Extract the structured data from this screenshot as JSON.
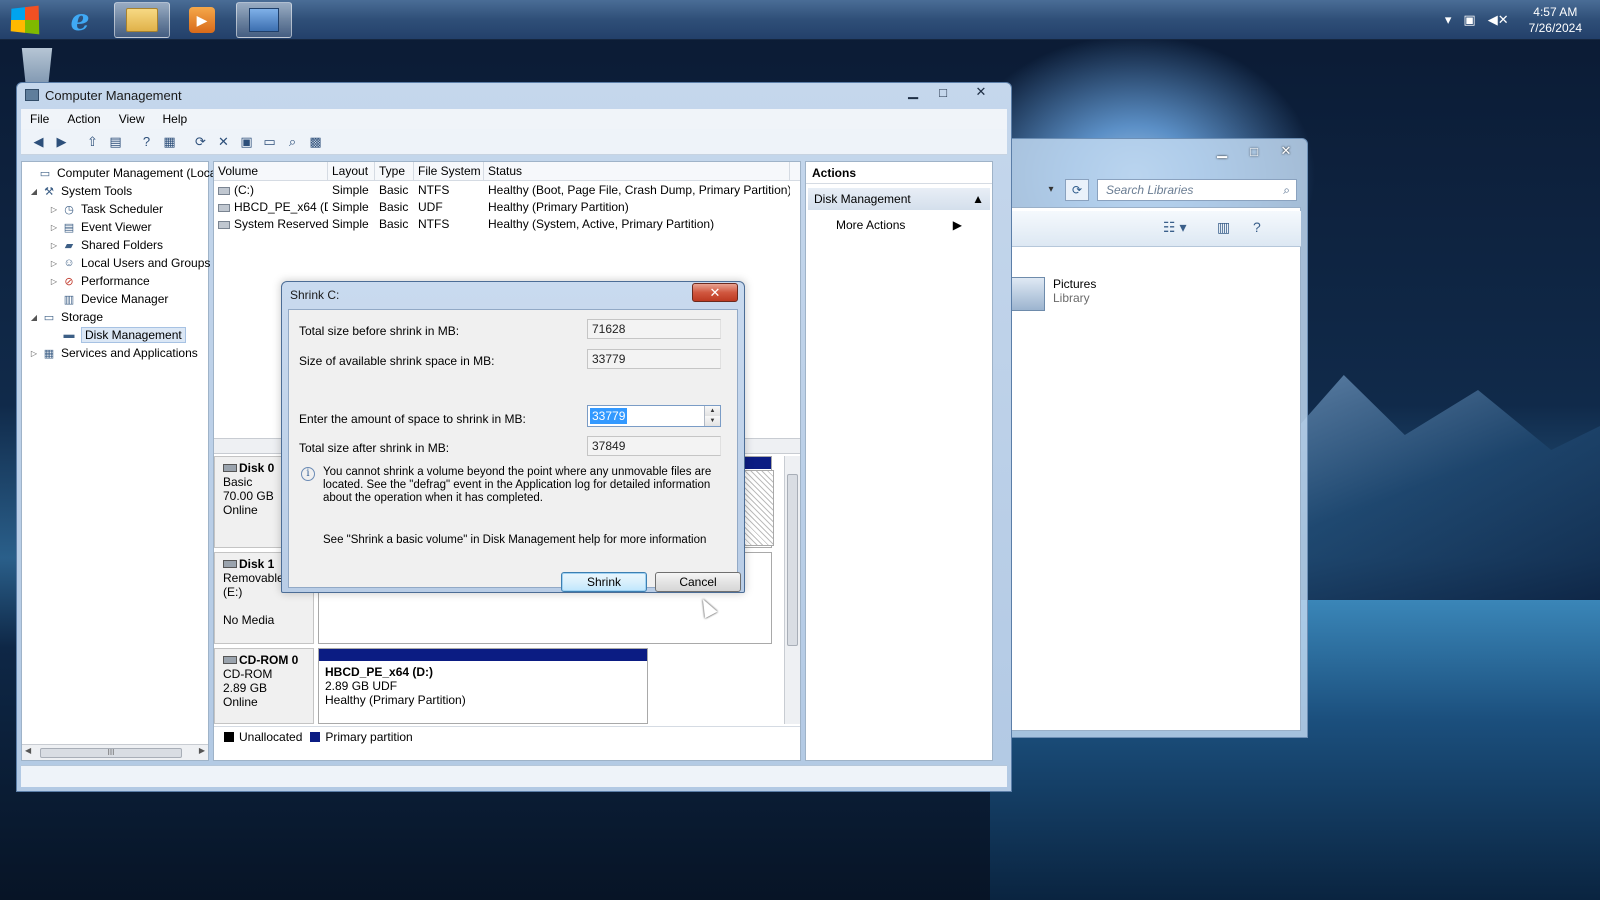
{
  "taskbar": {
    "clock_time": "4:57 AM",
    "clock_date": "7/26/2024",
    "apps": [
      "start-orb",
      "internet-explorer",
      "windows-explorer",
      "media-player",
      "computer-management"
    ],
    "tray_icons": [
      "show-hidden-icons",
      "network-icon",
      "volume-muted-icon"
    ]
  },
  "explorer": {
    "search_placeholder": "Search Libraries",
    "item_name": "Pictures",
    "item_type": "Library"
  },
  "window": {
    "title": "Computer Management",
    "menu": [
      "File",
      "Action",
      "View",
      "Help"
    ]
  },
  "tree": {
    "root": "Computer Management (Local",
    "system_tools": "System Tools",
    "task_scheduler": "Task Scheduler",
    "event_viewer": "Event Viewer",
    "shared_folders": "Shared Folders",
    "local_users": "Local Users and Groups",
    "performance": "Performance",
    "device_manager": "Device Manager",
    "storage": "Storage",
    "disk_management": "Disk Management",
    "services": "Services and Applications"
  },
  "volume_table": {
    "headers": [
      "Volume",
      "Layout",
      "Type",
      "File System",
      "Status"
    ],
    "rows": [
      {
        "volume": "(C:)",
        "layout": "Simple",
        "type": "Basic",
        "fs": "NTFS",
        "status": "Healthy (Boot, Page File, Crash Dump, Primary Partition)"
      },
      {
        "volume": "HBCD_PE_x64 (D:)",
        "layout": "Simple",
        "type": "Basic",
        "fs": "UDF",
        "status": "Healthy (Primary Partition)"
      },
      {
        "volume": "System Reserved",
        "layout": "Simple",
        "type": "Basic",
        "fs": "NTFS",
        "status": "Healthy (System, Active, Primary Partition)"
      }
    ]
  },
  "disks": {
    "disk0": {
      "name": "Disk 0",
      "type": "Basic",
      "size": "70.00 GB",
      "state": "Online"
    },
    "disk1": {
      "name": "Disk 1",
      "type": "Removable (E:)",
      "state": "No Media"
    },
    "cdrom0": {
      "name": "CD-ROM 0",
      "type": "CD-ROM",
      "size": "2.89 GB",
      "state": "Online",
      "partition_name": "HBCD_PE_x64  (D:)",
      "partition_size": "2.89 GB UDF",
      "partition_status": "Healthy (Primary Partition)"
    }
  },
  "legend": {
    "unallocated": "Unallocated",
    "primary": "Primary partition",
    "unallocated_color": "#000000",
    "primary_color": "#0b1c83"
  },
  "actions": {
    "header": "Actions",
    "section": "Disk Management",
    "more": "More Actions"
  },
  "dialog": {
    "title": "Shrink C:",
    "close": "✕",
    "total_before_label": "Total size before shrink in MB:",
    "total_before_value": "71628",
    "available_label": "Size of available shrink space in MB:",
    "available_value": "33779",
    "amount_label": "Enter the amount of space to shrink in MB:",
    "amount_value": "33779",
    "total_after_label": "Total size after shrink in MB:",
    "total_after_value": "37849",
    "info_text": "You cannot shrink a volume beyond the point where any unmovable files are located. See the \"defrag\" event in the Application log for detailed information about the operation when it has completed.",
    "help_text": "See \"Shrink a basic volume\" in Disk Management help for more information",
    "shrink_button": "Shrink",
    "cancel_button": "Cancel"
  }
}
